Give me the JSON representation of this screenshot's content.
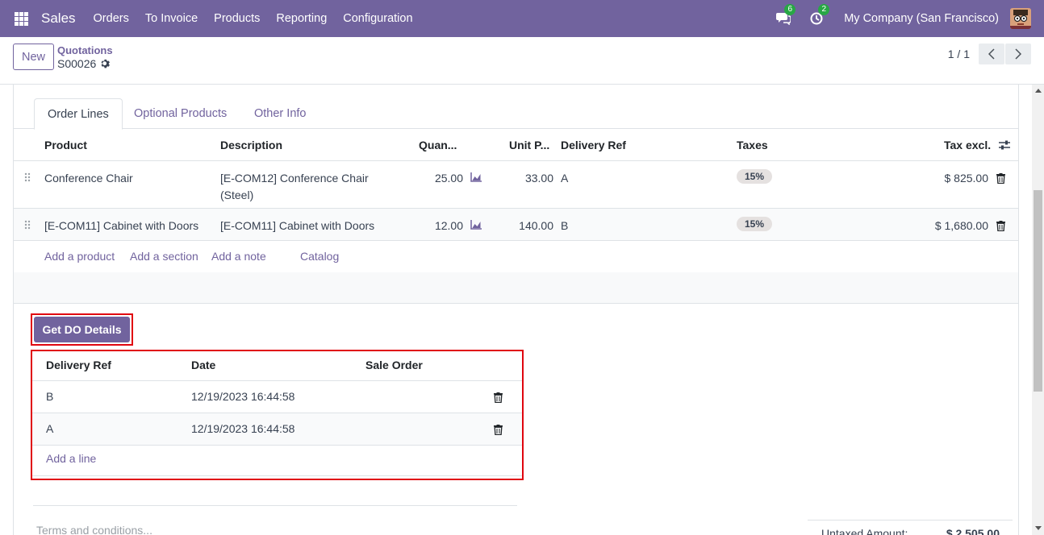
{
  "navbar": {
    "brand": "Sales",
    "menu": [
      "Orders",
      "To Invoice",
      "Products",
      "Reporting",
      "Configuration"
    ],
    "messages_count": "6",
    "activities_count": "2",
    "company": "My Company (San Francisco)",
    "bg_color": "#71639e"
  },
  "control_panel": {
    "new_label": "New",
    "breadcrumb": "Quotations",
    "record": "S00026",
    "pager": "1 / 1"
  },
  "tabs": [
    "Order Lines",
    "Optional Products",
    "Other Info"
  ],
  "order_lines": {
    "headers": {
      "product": "Product",
      "description": "Description",
      "quantity": "Quan...",
      "unit_price": "Unit P...",
      "delivery_ref": "Delivery Ref",
      "taxes": "Taxes",
      "tax_excl": "Tax excl."
    },
    "rows": [
      {
        "product": "Conference Chair",
        "description_line1": "[E-COM12] Conference Chair",
        "description_line2": "(Steel)",
        "quantity": "25.00",
        "unit_price": "33.00",
        "delivery_ref": "A",
        "tax": "15%",
        "subtotal": "$ 825.00"
      },
      {
        "product": "[E-COM11] Cabinet with Doors",
        "description_line1": "[E-COM11] Cabinet with Doors",
        "description_line2": "",
        "quantity": "12.00",
        "unit_price": "140.00",
        "delivery_ref": "B",
        "tax": "15%",
        "subtotal": "$ 1,680.00"
      }
    ],
    "actions": {
      "add_product": "Add a product",
      "add_section": "Add a section",
      "add_note": "Add a note",
      "catalog": "Catalog"
    }
  },
  "do_button": "Get DO Details",
  "do_table": {
    "headers": {
      "delivery_ref": "Delivery Ref",
      "date": "Date",
      "sale_order": "Sale Order"
    },
    "rows": [
      {
        "delivery_ref": "B",
        "date": "12/19/2023 16:44:58",
        "sale_order": ""
      },
      {
        "delivery_ref": "A",
        "date": "12/19/2023 16:44:58",
        "sale_order": ""
      }
    ],
    "add_line": "Add a line"
  },
  "terms_placeholder": "Terms and conditions...",
  "totals": {
    "untaxed_label": "Untaxed Amount:",
    "untaxed_value": "$ 2,505.00"
  }
}
